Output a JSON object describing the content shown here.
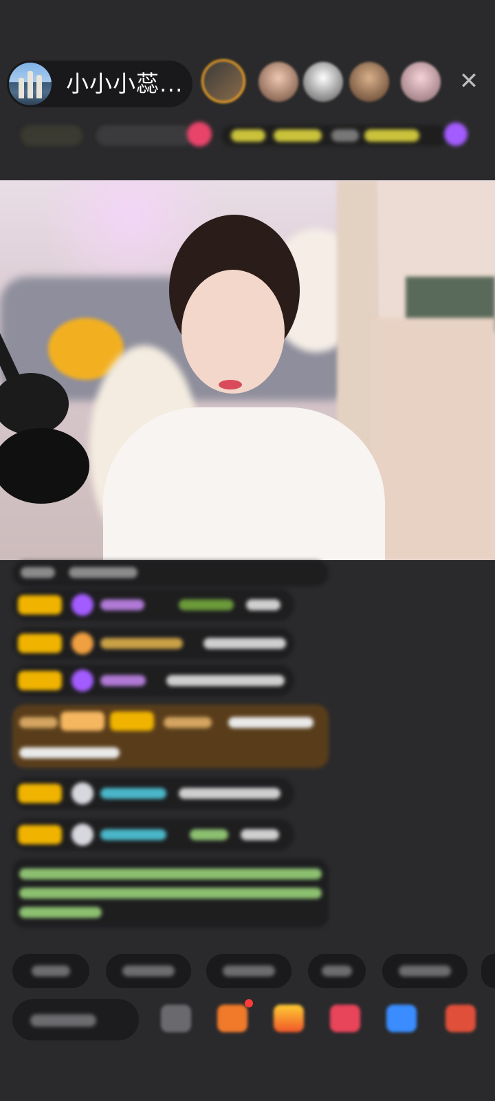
{
  "header": {
    "host_name": "小小小蕊..."
  },
  "icons": {
    "close": "close-icon"
  },
  "colors": {
    "background": "#2a2a2c",
    "accent_gold": "#f0b400",
    "accent_purple": "#a35cff"
  }
}
